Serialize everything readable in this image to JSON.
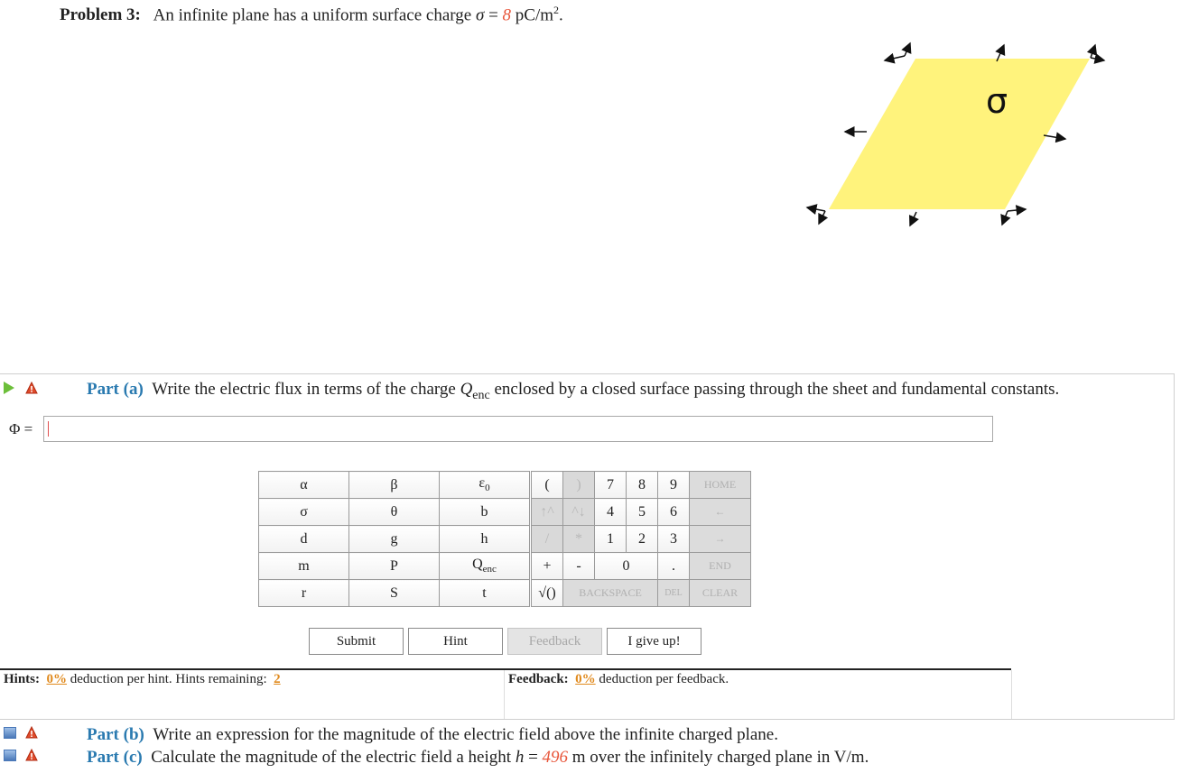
{
  "problem": {
    "label": "Problem 3:",
    "text_before": "An infinite plane has a uniform surface charge",
    "sigma_symbol": "σ",
    "equals": "=",
    "sigma_value": "8",
    "unit": "pC/m",
    "unit_exp": "2",
    "period": "."
  },
  "diagram": {
    "label": "σ",
    "fill_color": "#fff37c"
  },
  "part_a": {
    "label": "Part (a)",
    "text_1": "Write the electric flux in terms of the charge",
    "q_symbol": "Q",
    "q_sub": "enc",
    "text_2": "enclosed by a closed surface passing through the sheet and fundamental constants."
  },
  "answer": {
    "label": "Φ =",
    "value": ""
  },
  "keypad": {
    "letters": [
      [
        "α",
        "β",
        "ε0"
      ],
      [
        "σ",
        "θ",
        "b"
      ],
      [
        "d",
        "g",
        "h"
      ],
      [
        "m",
        "P",
        "Qenc"
      ],
      [
        "r",
        "S",
        "t"
      ]
    ],
    "ops": {
      "open_paren": "(",
      "close_paren": ")",
      "up_arrow": "↑^",
      "down_arrow": "^↓",
      "divide": "/",
      "multiply": "*",
      "plus": "+",
      "minus": "-",
      "sqrt": "√()",
      "digits": [
        "7",
        "8",
        "9",
        "4",
        "5",
        "6",
        "1",
        "2",
        "3",
        "0",
        "."
      ],
      "home": "HOME",
      "left": "←",
      "right": "→",
      "end": "END",
      "backspace": "BACKSPACE",
      "del": "DEL",
      "clear": "CLEAR"
    }
  },
  "buttons": {
    "submit": "Submit",
    "hint": "Hint",
    "feedback": "Feedback",
    "give_up": "I give up!"
  },
  "hints": {
    "label": "Hints:",
    "pct": "0%",
    "text": "deduction per hint. Hints remaining:",
    "remaining": "2"
  },
  "feedback": {
    "label": "Feedback:",
    "pct": "0%",
    "text": "deduction per feedback."
  },
  "part_b": {
    "label": "Part (b)",
    "text": "Write an expression for the magnitude of the electric field above the infinite charged plane."
  },
  "part_c": {
    "label": "Part (c)",
    "text_1": "Calculate the magnitude of the electric field a height",
    "h_symbol": "h",
    "equals": "=",
    "h_value": "496",
    "text_2": "m over the infinitely charged plane in V/m."
  },
  "colors": {
    "accent_blue": "#2a7ab0",
    "value_red": "#e8573c",
    "pct_orange": "#e08a1e"
  }
}
